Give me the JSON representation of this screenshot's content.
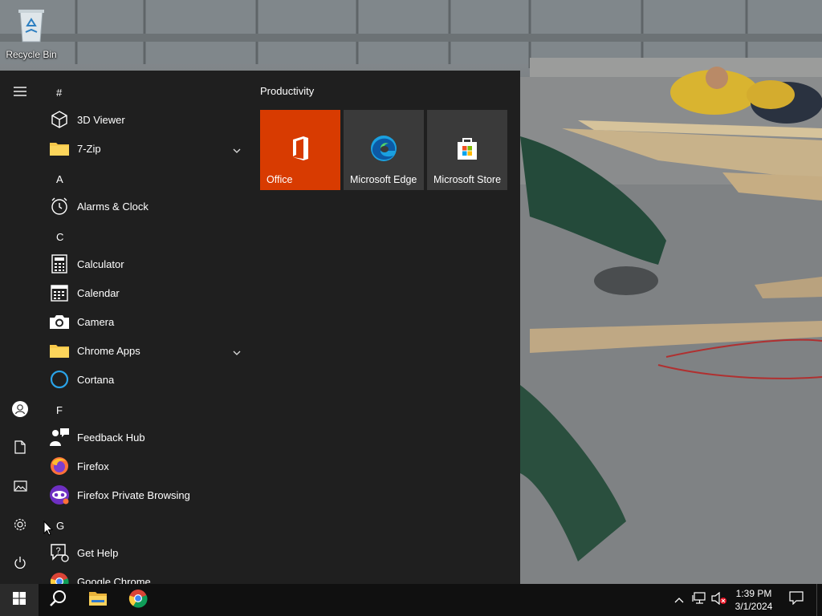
{
  "desktop": {
    "icons": [
      {
        "label": "Recycle Bin",
        "icon": "recycle-bin-icon"
      }
    ]
  },
  "start_menu": {
    "rail": [
      {
        "name": "expand",
        "icon": "hamburger-icon"
      },
      {
        "name": "user",
        "icon": "user-icon"
      },
      {
        "name": "documents",
        "icon": "document-icon"
      },
      {
        "name": "pictures",
        "icon": "pictures-icon"
      },
      {
        "name": "settings",
        "icon": "gear-icon"
      },
      {
        "name": "power",
        "icon": "power-icon"
      }
    ],
    "letters": [
      "#",
      "A",
      "C",
      "F",
      "G"
    ],
    "apps": [
      {
        "label": "3D Viewer",
        "icon": "cube-icon"
      },
      {
        "label": "7-Zip",
        "icon": "folder-icon",
        "expandable": true
      },
      {
        "label": "Alarms & Clock",
        "icon": "alarm-clock-icon"
      },
      {
        "label": "Calculator",
        "icon": "calculator-icon"
      },
      {
        "label": "Calendar",
        "icon": "calendar-icon"
      },
      {
        "label": "Camera",
        "icon": "camera-icon"
      },
      {
        "label": "Chrome Apps",
        "icon": "folder-icon",
        "expandable": true
      },
      {
        "label": "Cortana",
        "icon": "cortana-icon"
      },
      {
        "label": "Feedback Hub",
        "icon": "feedback-icon"
      },
      {
        "label": "Firefox",
        "icon": "firefox-icon"
      },
      {
        "label": "Firefox Private Browsing",
        "icon": "firefox-private-icon"
      },
      {
        "label": "Get Help",
        "icon": "help-icon"
      },
      {
        "label": "Google Chrome",
        "icon": "chrome-icon"
      }
    ],
    "tile_group": {
      "title": "Productivity",
      "tiles": [
        {
          "label": "Office",
          "icon": "office-icon",
          "color": "#d83b01"
        },
        {
          "label": "Microsoft Edge",
          "icon": "edge-icon",
          "color": "#3a3a3a"
        },
        {
          "label": "Microsoft Store",
          "icon": "store-icon",
          "color": "#3a3a3a"
        }
      ]
    }
  },
  "taskbar": {
    "pinned": [
      {
        "name": "start",
        "icon": "windows-icon"
      },
      {
        "name": "search",
        "icon": "search-icon"
      },
      {
        "name": "file-explorer",
        "icon": "folder-icon"
      },
      {
        "name": "chrome",
        "icon": "chrome-icon"
      }
    ],
    "tray": {
      "icons": [
        "chevron-up-icon",
        "network-icon",
        "volume-muted-icon",
        "notification-icon"
      ],
      "time": "1:39 PM",
      "date": "3/1/2024"
    }
  },
  "colors": {
    "menu_bg": "#1f1f1f",
    "taskbar_bg": "#101010",
    "office_tile": "#d83b01",
    "tile_bg": "#3a3a3a",
    "folder": "#f7c84a"
  }
}
